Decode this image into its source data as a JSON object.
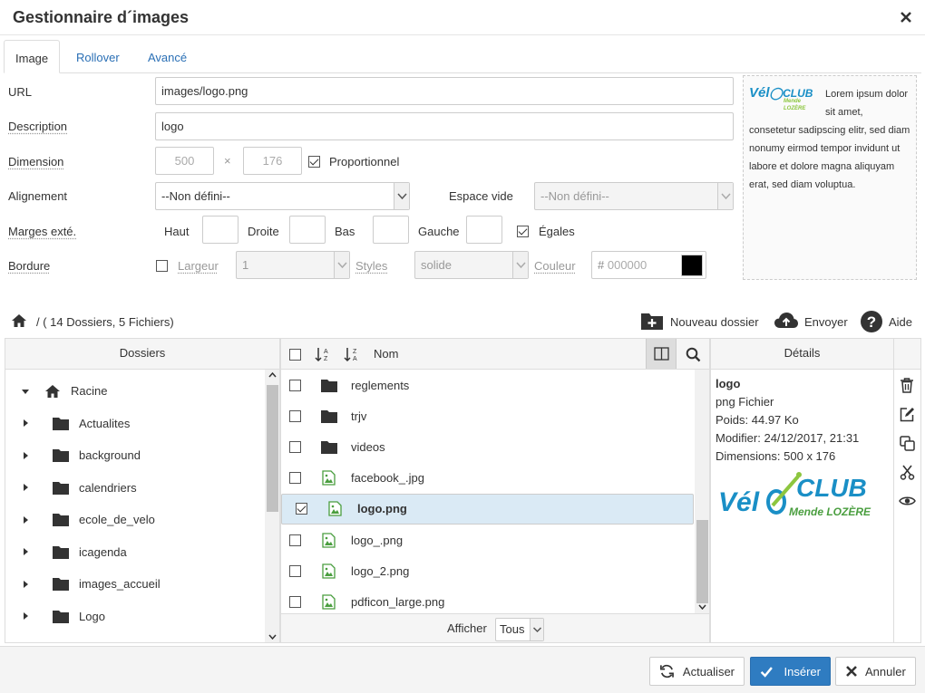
{
  "dialog": {
    "title": "Gestionnaire d´images"
  },
  "tabs": [
    {
      "label": "Image"
    },
    {
      "label": "Rollover"
    },
    {
      "label": "Avancé"
    }
  ],
  "form": {
    "url_label": "URL",
    "url_value": "images/logo.png",
    "desc_label": "Description",
    "desc_value": "logo",
    "dim_label": "Dimension",
    "width": "500",
    "times": "×",
    "height": "176",
    "proportional": "Proportionnel",
    "align_label": "Alignement",
    "align_value": "--Non défini--",
    "space_label": "Espace vide",
    "space_value": "--Non défini--",
    "margins_label": "Marges exté.",
    "top": "Haut",
    "right": "Droite",
    "bottom": "Bas",
    "left": "Gauche",
    "equal": "Égales",
    "border_label": "Bordure",
    "width_label": "Largeur",
    "border_width": "1",
    "styles_label": "Styles",
    "style_value": "solide",
    "color_label": "Couleur",
    "color_hash": "#",
    "color_value": "000000"
  },
  "preview": {
    "logo_text_1": "Vél",
    "logo_text_2": "CLUB",
    "logo_sub": "Mende LOZÈRE",
    "text": "Lorem ipsum dolor sit amet, consetetur sadipscing elitr, sed diam nonumy eirmod tempor invidunt ut labore et dolore magna aliquyam erat, sed diam voluptua."
  },
  "toolbar": {
    "path": "/ ( 14 Dossiers, 5 Fichiers)",
    "new_folder": "Nouveau dossier",
    "upload": "Envoyer",
    "help": "Aide"
  },
  "folders": {
    "header": "Dossiers",
    "root": "Racine",
    "items": [
      {
        "name": "Actualites"
      },
      {
        "name": "background"
      },
      {
        "name": "calendriers"
      },
      {
        "name": "ecole_de_velo"
      },
      {
        "name": "icagenda"
      },
      {
        "name": "images_accueil"
      },
      {
        "name": "Logo"
      }
    ]
  },
  "files": {
    "name_header": "Nom",
    "items": [
      {
        "name": "reglements",
        "type": "folder",
        "checked": false
      },
      {
        "name": "trjv",
        "type": "folder",
        "checked": false
      },
      {
        "name": "videos",
        "type": "folder",
        "checked": false
      },
      {
        "name": "facebook_.jpg",
        "type": "image",
        "checked": false
      },
      {
        "name": "logo.png",
        "type": "image",
        "checked": true
      },
      {
        "name": "logo_.png",
        "type": "image",
        "checked": false
      },
      {
        "name": "logo_2.png",
        "type": "image",
        "checked": false
      },
      {
        "name": "pdficon_large.png",
        "type": "image",
        "checked": false
      }
    ],
    "show_label": "Afficher",
    "show_value": "Tous"
  },
  "details": {
    "header": "Détails",
    "name": "logo",
    "type": "png Fichier",
    "size": "Poids: 44.97 Ko",
    "modified": "Modifier: 24/12/2017, 21:31",
    "dimensions": "Dimensions: 500 x 176"
  },
  "footer": {
    "refresh": "Actualiser",
    "insert": "Insérer",
    "cancel": "Annuler"
  },
  "colors": {
    "accent": "#2f7cc1",
    "logo_blue": "#1a8fc6",
    "logo_green": "#8dc63f",
    "selected_row": "#daeaf5"
  }
}
